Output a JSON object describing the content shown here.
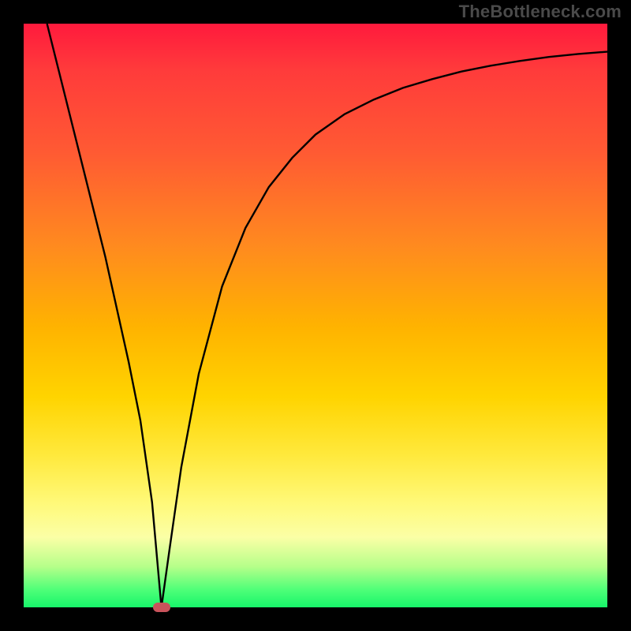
{
  "watermark": "TheBottleneck.com",
  "chart_data": {
    "type": "line",
    "title": "",
    "xlabel": "",
    "ylabel": "",
    "xlim": [
      0,
      100
    ],
    "ylim": [
      0,
      100
    ],
    "grid": false,
    "curve": {
      "x": [
        4,
        6,
        8,
        10,
        12,
        14,
        16,
        18,
        20,
        22,
        23.6,
        25,
        27,
        30,
        34,
        38,
        42,
        46,
        50,
        55,
        60,
        65,
        70,
        75,
        80,
        85,
        90,
        95,
        100
      ],
      "y": [
        100,
        92,
        84,
        76,
        68,
        60,
        51,
        42,
        32,
        18,
        0,
        10,
        24,
        40,
        55,
        65,
        72,
        77,
        81,
        84.5,
        87,
        89,
        90.5,
        91.8,
        92.8,
        93.6,
        94.3,
        94.8,
        95.2
      ]
    },
    "marker": {
      "x": 23.6,
      "y": 0
    },
    "colors": {
      "curve": "#000000",
      "marker": "#c9535b",
      "gradient_top": "#ff1a3d",
      "gradient_mid": "#ffd400",
      "gradient_bottom": "#17f56a",
      "frame": "#000000"
    }
  }
}
